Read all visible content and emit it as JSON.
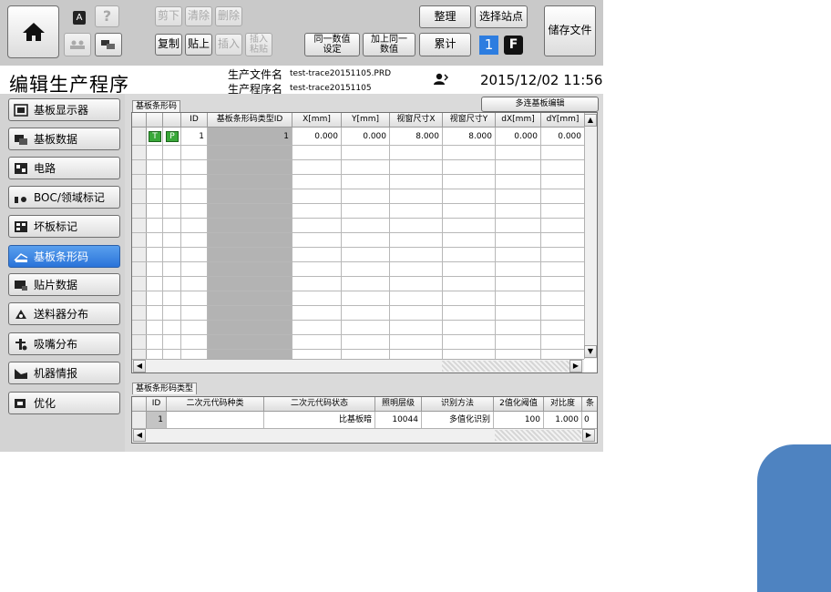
{
  "toolbar": {
    "cut": "剪下",
    "clear": "清除",
    "delete": "删除",
    "copy": "复制",
    "paste": "贴上",
    "insert": "插入",
    "insert_paste": "插入\n粘贴",
    "same_value_set": "同一数值\n设定",
    "add_same_value": "加上同一\n数值",
    "organize": "整理",
    "select_station": "选择站点",
    "cumulative": "累计",
    "station_number": "1",
    "f_badge": "F",
    "save_file": "储存文件",
    "a_icon": "A",
    "help": "?"
  },
  "header": {
    "title": "编辑生产程序",
    "file_label": "生产文件名",
    "file_value": "test-trace20151105.PRD",
    "program_label": "生产程序名",
    "program_value": "test-trace20151105",
    "datetime": "2015/12/02 11:56"
  },
  "sidebar": {
    "items": [
      {
        "label": "基板显示器",
        "icon": "board-display-icon"
      },
      {
        "label": "基板数据",
        "icon": "board-data-icon"
      },
      {
        "label": "电路",
        "icon": "circuit-icon"
      },
      {
        "label": "BOC/领域标记",
        "icon": "boc-mark-icon"
      },
      {
        "label": "坏板标记",
        "icon": "bad-board-icon"
      },
      {
        "label": "基板条形码",
        "icon": "barcode-icon",
        "active": true
      },
      {
        "label": "贴片数据",
        "icon": "placement-data-icon"
      },
      {
        "label": "送料器分布",
        "icon": "feeder-icon"
      },
      {
        "label": "吸嘴分布",
        "icon": "nozzle-icon"
      },
      {
        "label": "机器情报",
        "icon": "machine-info-icon"
      },
      {
        "label": "优化",
        "icon": "optimize-icon"
      }
    ]
  },
  "barcode_grid": {
    "tab": "基板条形码",
    "multi_edit": "多连基板编辑",
    "headers": [
      "ID",
      "基板条形码类型ID",
      "X[mm]",
      "Y[mm]",
      "视窗尺寸X",
      "视窗尺寸Y",
      "dX[mm]",
      "dY[mm]"
    ],
    "row": {
      "t": "T",
      "p": "P",
      "id": "1",
      "type_id": "1",
      "x": "0.000",
      "y": "0.000",
      "wx": "8.000",
      "wy": "8.000",
      "dx": "0.000",
      "dy": "0.000"
    }
  },
  "type_grid": {
    "tab": "基板条形码类型",
    "headers": [
      "ID",
      "二次元代码种类",
      "二次元代码状态",
      "照明层级",
      "识别方法",
      "2值化阈值",
      "对比度",
      "条"
    ],
    "row": {
      "id": "1",
      "kind": "",
      "state": "比基板暗",
      "light": "10044",
      "method": "多值化识别",
      "threshold": "100",
      "contrast": "1.000",
      "extra": "0"
    }
  },
  "colors": {
    "active": "#2a73d9",
    "accent_block": "#4e83c1",
    "badge_blue": "#2d7de0"
  }
}
